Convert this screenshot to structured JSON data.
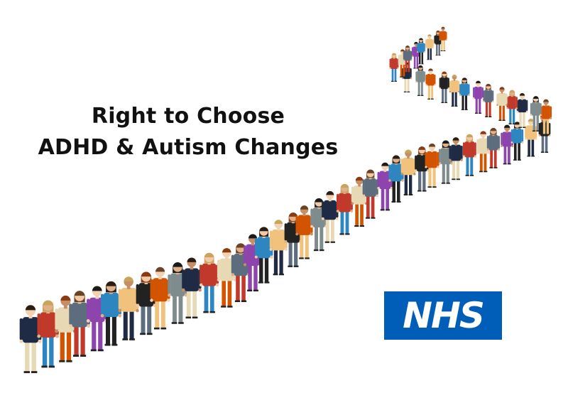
{
  "title": {
    "line1": "Right to Choose",
    "line2": "ADHD & Autism Changes"
  },
  "logo": {
    "text": "NHS",
    "background": "#005EB8",
    "foreground": "#FFFFFF"
  },
  "illustration": {
    "subject": "winding-queue-of-people",
    "palette": [
      "#1f2a44",
      "#c0392b",
      "#e8d9b5",
      "#5d6d7e",
      "#8e44ad",
      "#2e86c1",
      "#f0c27b",
      "#222222",
      "#d35400",
      "#7f8c8d"
    ]
  }
}
